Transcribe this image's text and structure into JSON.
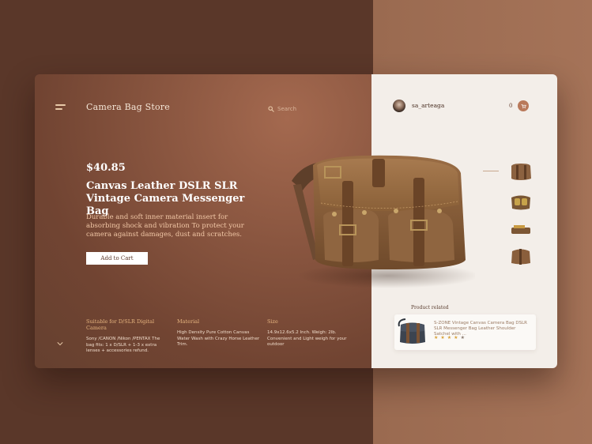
{
  "header": {
    "store_title": "Camera Bag Store",
    "search_placeholder": "Search",
    "username": "sa_arteaga",
    "cart_count": "0"
  },
  "product": {
    "price": "$40.85",
    "name": "Canvas Leather DSLR SLR Vintage Camera Messenger Bag",
    "description": "Durable and soft inner material insert for absorbing shock and vibration To protect your camera against damages, dust and scratches.",
    "add_to_cart_label": "Add to Cart"
  },
  "specs": [
    {
      "title": "Suitable for D/SLR Digital Camera",
      "text": "Sony /CANON /Nikon /PENTAX The bag fits: 1 x D/SLR + 1-3 x extra lenses + accessories refund."
    },
    {
      "title": "Material",
      "text": "High Density Pure Cotton Canvas Water Wash with Crazy Horse Leather Trim."
    },
    {
      "title": "Size",
      "text": "14.9x12.6x5.2 Inch. Weigh: 2lb. Convenient and Light weigh for your outdoor"
    }
  ],
  "related": {
    "title": "Product related",
    "item_text": "S-ZONE Vintage Canvas Camera Bag DSLR SLR Messenger Bag Leather Shoulder Satchel with ...",
    "rating": 4,
    "rating_max": 5
  },
  "icons": {
    "menu": "menu-icon",
    "search": "search-icon",
    "cart": "cart-icon",
    "scroll": "chevron-down-icon",
    "star": "star-icon"
  },
  "colors": {
    "accent": "#b9795a",
    "background_dark": "#5a3729",
    "panel_light": "#f3eee9",
    "star": "#d8a23a"
  }
}
